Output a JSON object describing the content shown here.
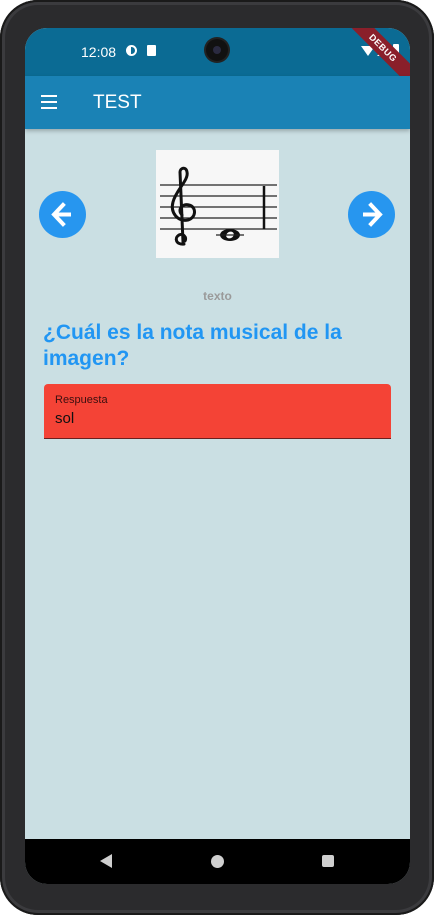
{
  "status_bar": {
    "time": "12:08",
    "icons": [
      "data-saver-icon",
      "sd-card-icon",
      "wifi-icon",
      "cellular-icon",
      "battery-icon"
    ],
    "debug_banner": "DEBUG"
  },
  "app_bar": {
    "menu_icon": "hamburger-menu-icon",
    "title": "TEST",
    "color": "#1a82b5"
  },
  "content": {
    "image": "treble-clef-whole-note-image",
    "prev_icon": "arrow-left-icon",
    "next_icon": "arrow-right-icon",
    "caption": "texto",
    "question": "¿Cuál es la nota musical de la imagen?",
    "answer": {
      "label": "Respuesta",
      "value": "sol",
      "color": "#f44336"
    }
  },
  "system_nav": {
    "back_icon": "back-triangle-icon",
    "home_icon": "home-circle-icon",
    "recents_icon": "recents-square-icon"
  },
  "colors": {
    "background": "#cadfe3",
    "accent": "#2196f3"
  }
}
